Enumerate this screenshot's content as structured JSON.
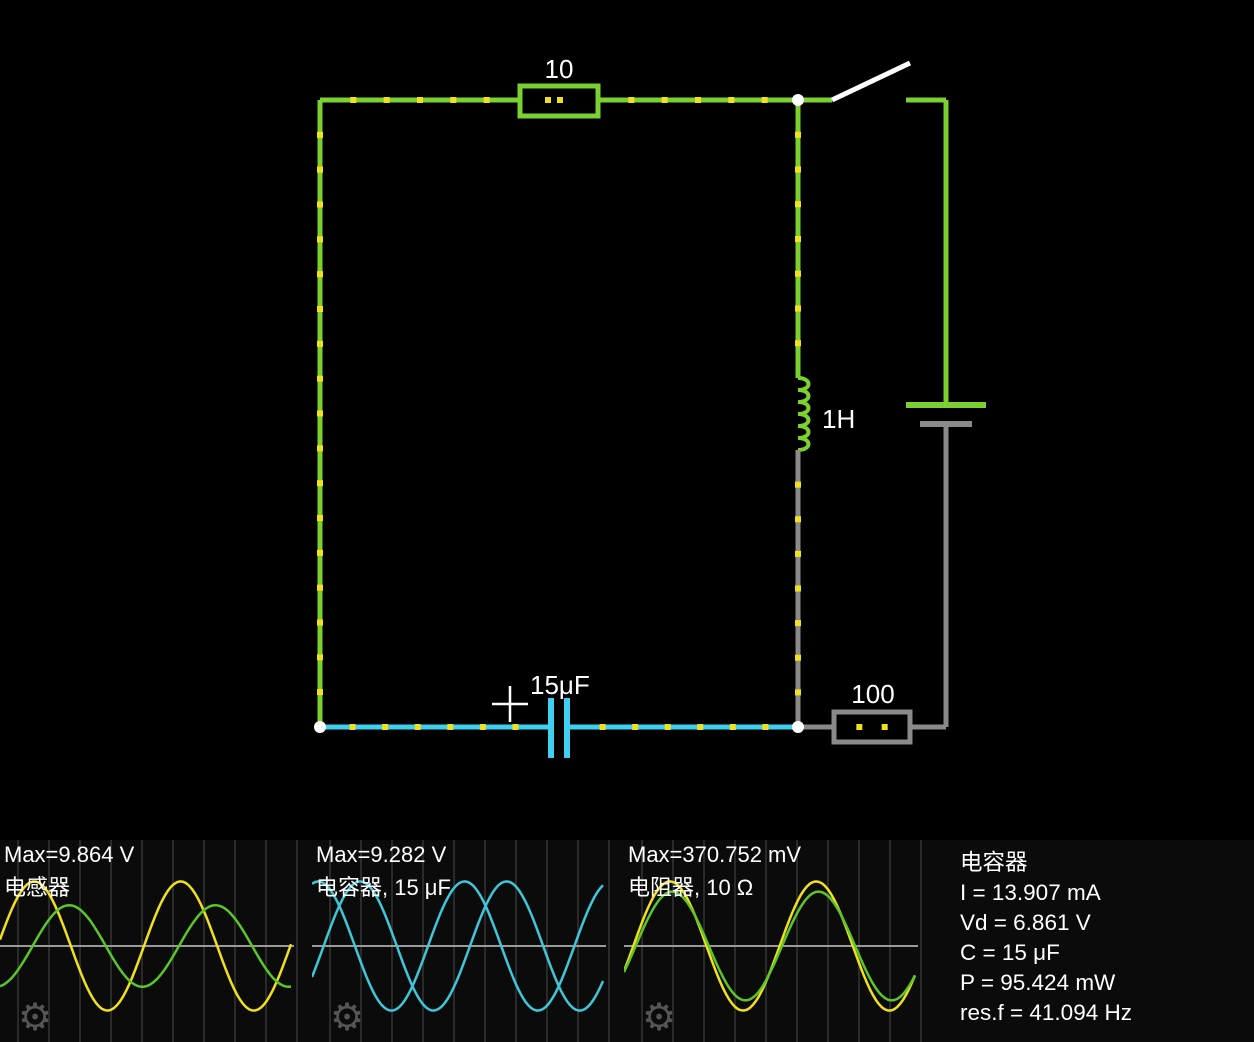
{
  "circuit": {
    "labels": {
      "resistor_top": "10",
      "inductor": "1H",
      "capacitor": "15μF",
      "resistor_bottom": "100"
    },
    "colors": {
      "active_wire": "#7bd12f",
      "capacitor_wire": "#3fd0f0",
      "inactive_wire": "#8a8a8a",
      "current_dot": "#f2e11a",
      "switch": "#ffffff"
    },
    "switch_state": "open"
  },
  "scopes": [
    {
      "max": "Max=9.864 V",
      "label": "电感器",
      "icon": "gear-icon",
      "traces": [
        {
          "color": "#f2e11a",
          "phase": 0.1,
          "amp": 0.95
        },
        {
          "color": "#5cc52a",
          "phase": -1.4,
          "amp": 0.6
        }
      ]
    },
    {
      "max": "Max=9.282 V",
      "label": "电容器, 15 μF",
      "icon": "gear-icon",
      "traces": [
        {
          "color": "#3fc6d8",
          "phase": -0.5,
          "amp": 0.95
        },
        {
          "color": "#3fc6d8",
          "phase": 1.3,
          "amp": 0.95
        }
      ]
    },
    {
      "max": "Max=370.752 mV",
      "label": "电阻器, 10 Ω",
      "icon": "gear-icon",
      "traces": [
        {
          "color": "#f2e11a",
          "phase": -0.4,
          "amp": 0.95
        },
        {
          "color": "#5cc52a",
          "phase": -0.5,
          "amp": 0.8
        }
      ]
    }
  ],
  "info": {
    "title": "电容器",
    "current": "I = 13.907 mA",
    "voltage": "Vd = 6.861 V",
    "capacitance": "C = 15 μF",
    "power": "P = 95.424 mW",
    "res_freq": "res.f = 41.094 Hz"
  }
}
